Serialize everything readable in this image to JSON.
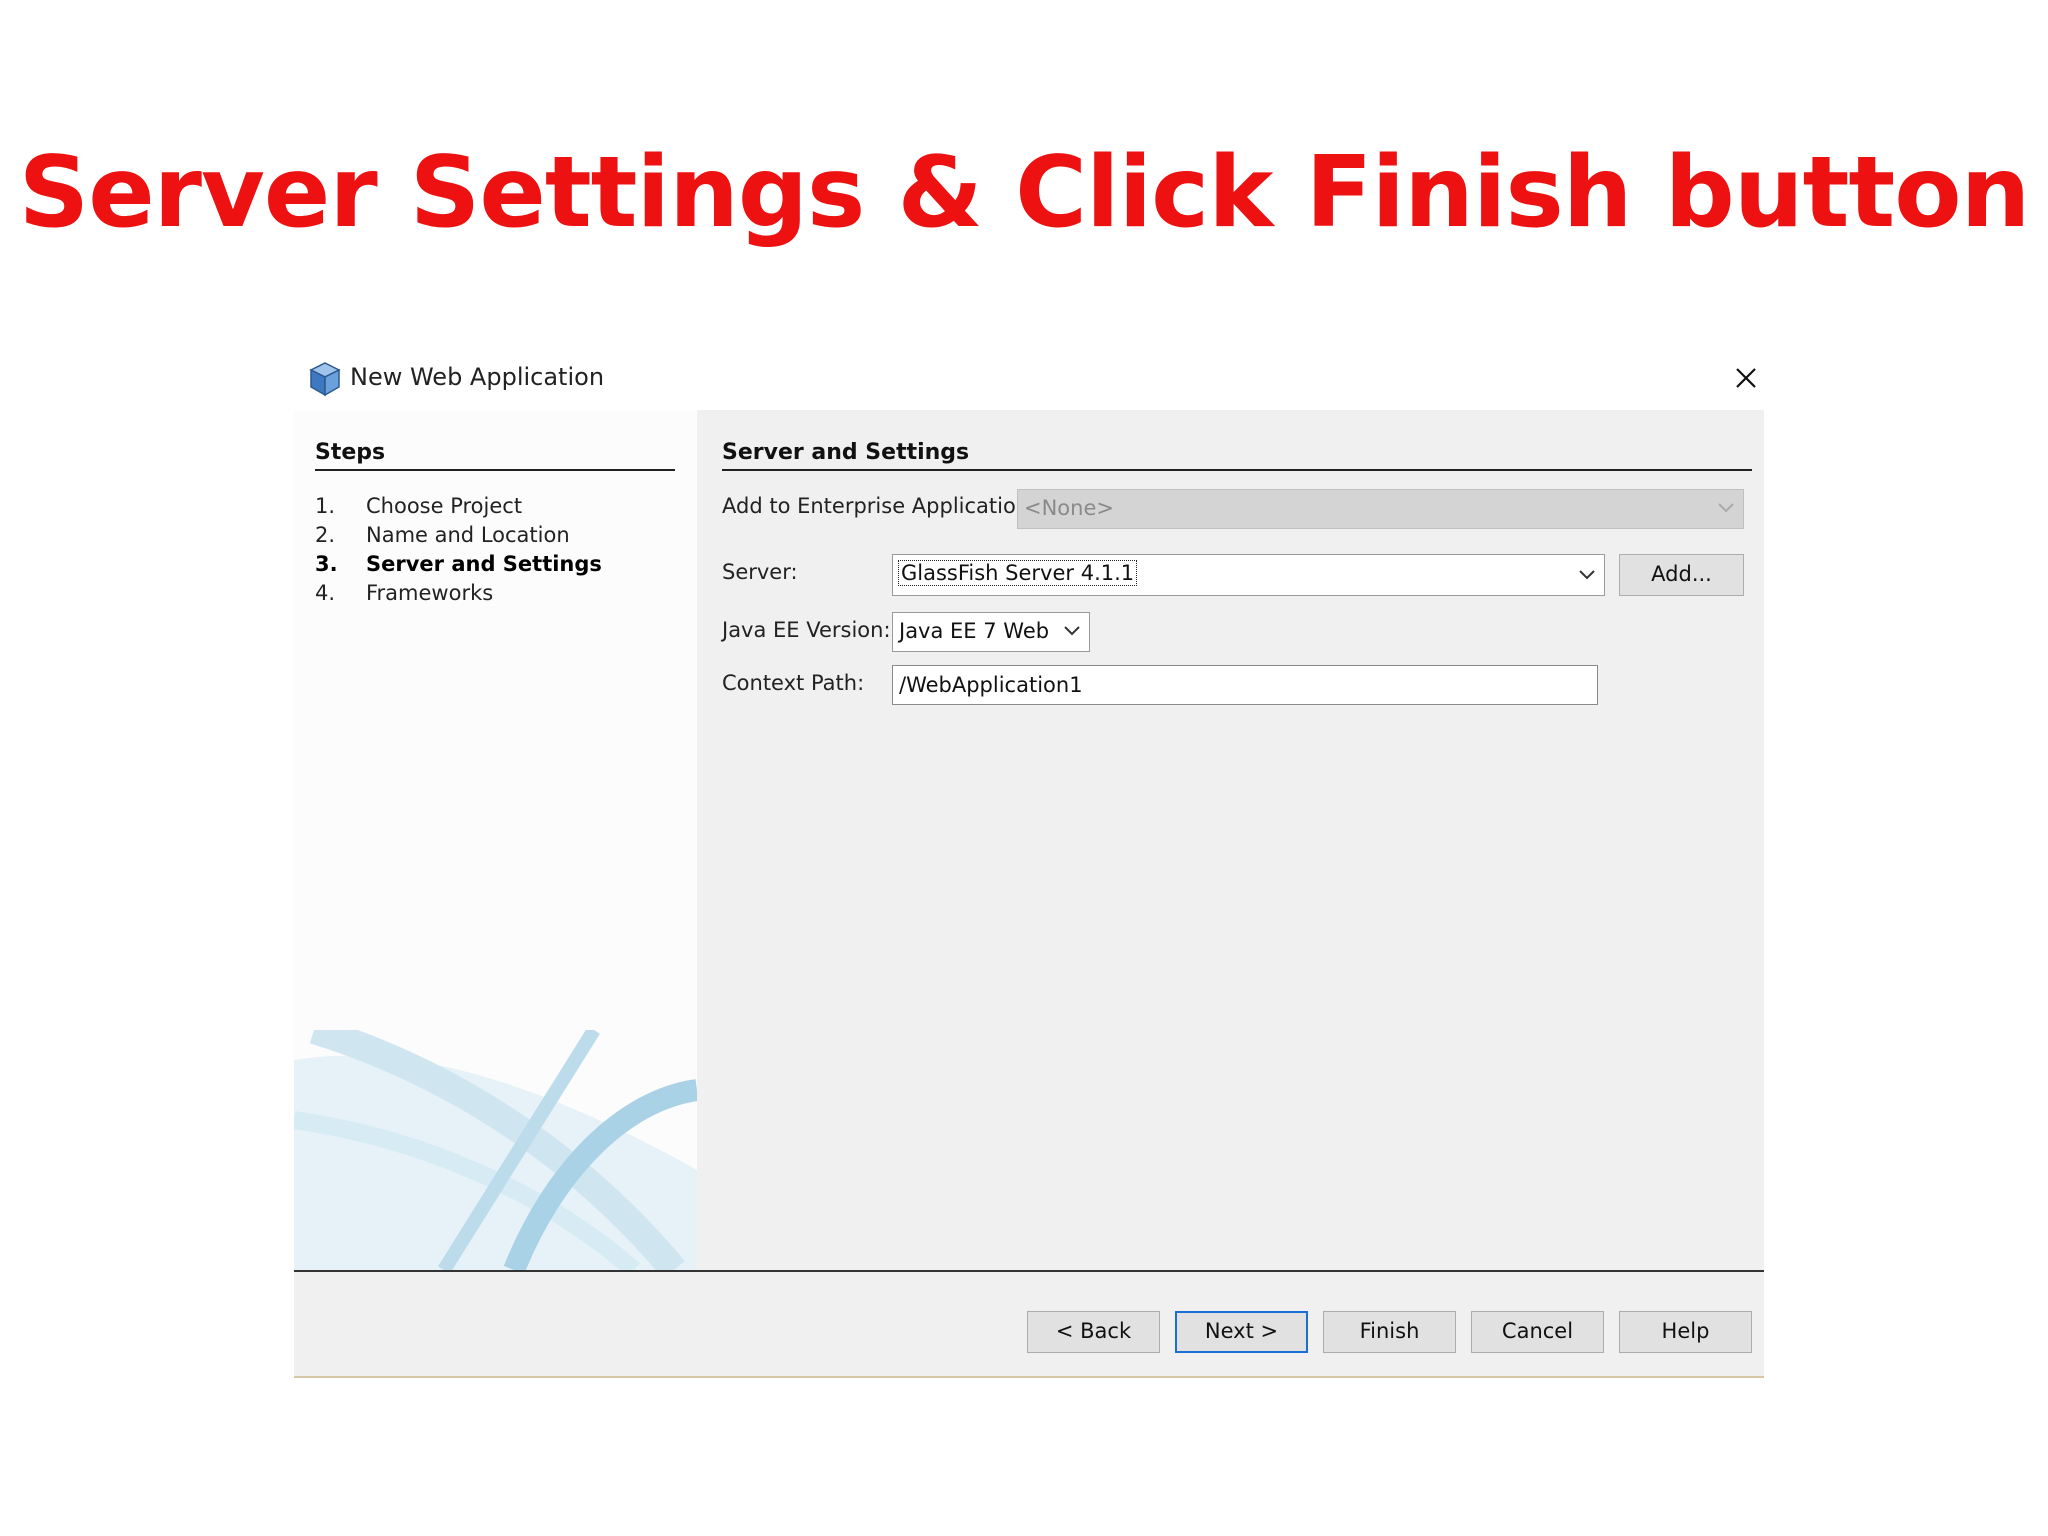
{
  "slide": {
    "title": "Server Settings & Click Finish button"
  },
  "window": {
    "title": "New Web Application",
    "icon": "cube-icon",
    "close_icon": "close-icon"
  },
  "steps": {
    "heading": "Steps",
    "items": [
      {
        "num": "1.",
        "label": "Choose Project"
      },
      {
        "num": "2.",
        "label": "Name and Location"
      },
      {
        "num": "3.",
        "label": "Server and Settings",
        "current": true
      },
      {
        "num": "4.",
        "label": "Frameworks"
      }
    ]
  },
  "content": {
    "heading": "Server and Settings",
    "enterprise": {
      "label": "Add to Enterprise Application:",
      "value": "<None>"
    },
    "server": {
      "label": "Server:",
      "value": "GlassFish Server 4.1.1",
      "add_label": "Add..."
    },
    "javaee": {
      "label": "Java EE Version:",
      "value": "Java EE 7 Web"
    },
    "context": {
      "label": "Context Path:",
      "value": "/WebApplication1"
    }
  },
  "buttons": {
    "back": "< Back",
    "next": "Next >",
    "finish": "Finish",
    "cancel": "Cancel",
    "help": "Help"
  },
  "colors": {
    "title_red": "#ee1111",
    "focus_blue": "#1a6fd6",
    "panel_bg": "#f0f0f0"
  }
}
